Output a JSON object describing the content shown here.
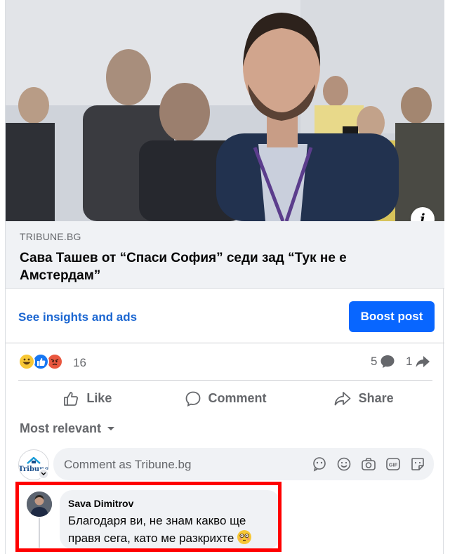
{
  "link_preview": {
    "domain": "TRIBUNE.BG",
    "headline": "Сава Ташев от “Спаси София” седи зад “Тук не е Амстердам”"
  },
  "insights": {
    "link_label": "See insights and ads",
    "boost_label": "Boost post"
  },
  "reactions": {
    "types": [
      "haha-icon",
      "like-icon",
      "angry-icon"
    ],
    "count": "16",
    "comments_count": "5",
    "shares_count": "1"
  },
  "actions": {
    "like": "Like",
    "comment": "Comment",
    "share": "Share"
  },
  "sort": {
    "label": "Most relevant"
  },
  "composer": {
    "avatar_text": "Tribune",
    "placeholder": "Comment as Tribune.bg"
  },
  "comment": {
    "author": "Sava Dimitrov",
    "text": "Благодаря ви, не знам какво ще правя сега, като ме разкрихте",
    "highlight_color": "#ff0000"
  },
  "colors": {
    "accent": "#0866ff",
    "link": "#1b66d1",
    "secondary_text": "#65676b"
  }
}
